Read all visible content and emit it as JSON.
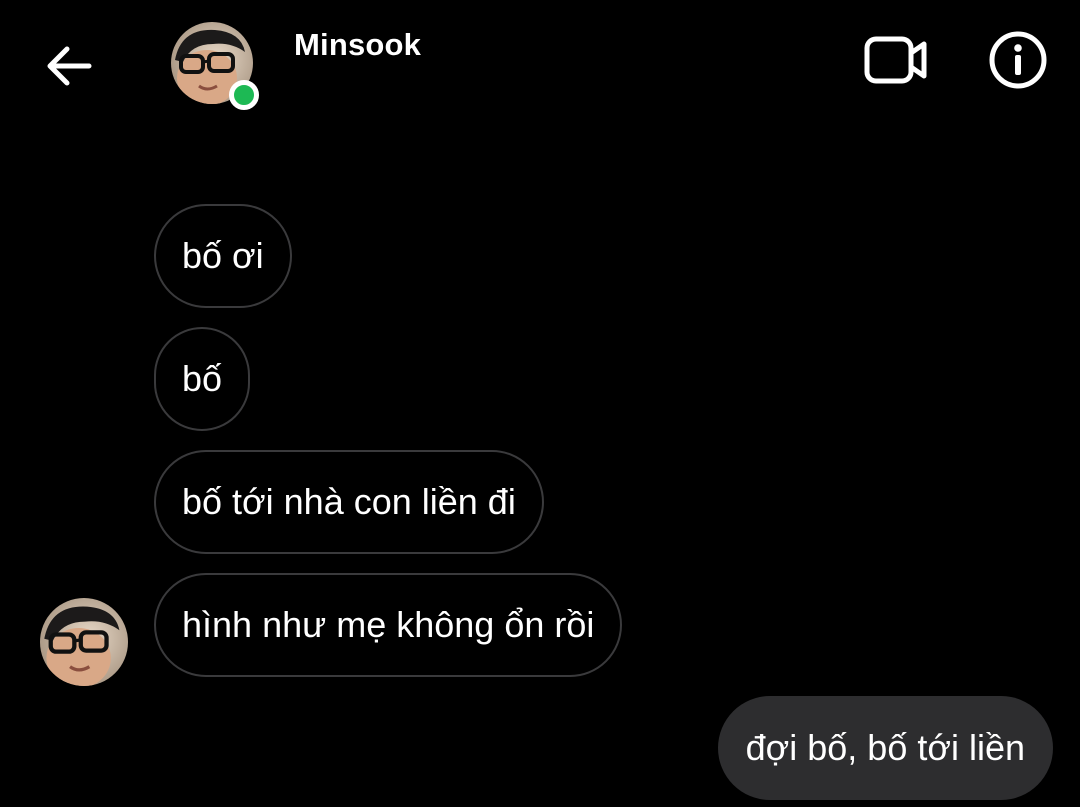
{
  "header": {
    "contact_name": "Minsook",
    "online": true,
    "online_color": "#1db954",
    "back_icon": "arrow-left-icon",
    "video_icon": "video-camera-icon",
    "info_icon": "info-icon"
  },
  "messages": [
    {
      "direction": "received",
      "text": "bố ơi"
    },
    {
      "direction": "received",
      "text": "bố"
    },
    {
      "direction": "received",
      "text": "bố tới nhà con liền đi"
    },
    {
      "direction": "received",
      "text": "hình như mẹ không ổn rồi"
    },
    {
      "direction": "sent",
      "text": "đợi bố, bố tới liền"
    }
  ],
  "colors": {
    "background": "#000000",
    "received_border": "#3a3a3c",
    "sent_bubble": "#2d2d2f",
    "text": "#ffffff"
  }
}
